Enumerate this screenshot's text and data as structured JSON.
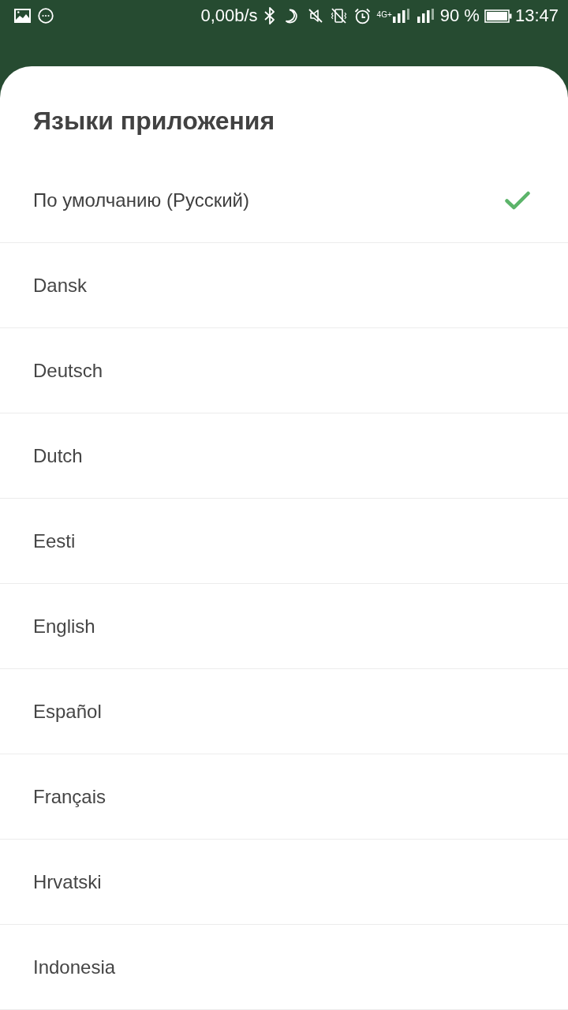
{
  "status_bar": {
    "speed": "0,00b/s",
    "network": "4G+",
    "battery": "90 %",
    "time": "13:47"
  },
  "sheet": {
    "title": "Языки приложения",
    "languages": [
      {
        "label": "По умолчанию (Русский)",
        "selected": true
      },
      {
        "label": "Dansk",
        "selected": false
      },
      {
        "label": "Deutsch",
        "selected": false
      },
      {
        "label": "Dutch",
        "selected": false
      },
      {
        "label": "Eesti",
        "selected": false
      },
      {
        "label": "English",
        "selected": false
      },
      {
        "label": "Español",
        "selected": false
      },
      {
        "label": "Français",
        "selected": false
      },
      {
        "label": "Hrvatski",
        "selected": false
      },
      {
        "label": "Indonesia",
        "selected": false
      }
    ]
  }
}
